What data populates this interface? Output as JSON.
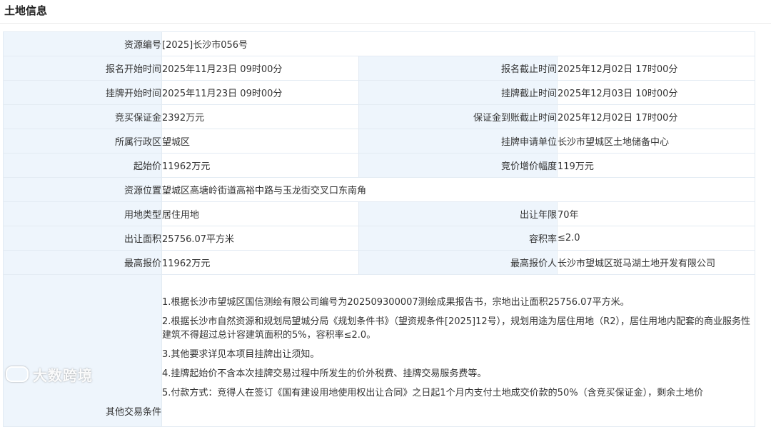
{
  "section_title": "土地信息",
  "rows": [
    {
      "label": "资源编号",
      "value": "[2025]长沙市056号"
    },
    {
      "label": "报名开始时间",
      "value": "2025年11月23日 09时00分",
      "label2": "报名截止时间",
      "value2": "2025年12月02日 17时00分"
    },
    {
      "label": "挂牌开始时间",
      "value": "2025年11月23日 09时00分",
      "label2": "挂牌截止时间",
      "value2": "2025年12月03日 10时00分"
    },
    {
      "label": "竞买保证金",
      "value": "2392万元",
      "label2": "保证金到账截止时间",
      "value2": "2025年12月02日 17时00分"
    },
    {
      "label": "所属行政区",
      "value": "望城区",
      "label2": "挂牌申请单位",
      "value2": "长沙市望城区土地储备中心"
    },
    {
      "label": "起始价",
      "value": "11962万元",
      "label2": "竞价增价幅度",
      "value2": "119万元"
    },
    {
      "label": "资源位置",
      "value": "望城区高塘岭街道高裕中路与玉龙街交叉口东南角"
    },
    {
      "label": "用地类型",
      "value": "居住用地",
      "label2": "出让年限",
      "value2": "70年"
    },
    {
      "label": "出让面积",
      "value": "25756.07平方米",
      "label2": "容积率",
      "value2": "≤2.0"
    },
    {
      "label": "最高报价",
      "value": "11962万元",
      "label2": "最高报价人",
      "value2": "长沙市望城区斑马湖土地开发有限公司"
    }
  ],
  "notes": {
    "label": "其他交易条件",
    "items": [
      "1.根据长沙市望城区国信测绘有限公司编号为202509300007测绘成果报告书，宗地出让面积25756.07平方米。",
      "2.根据长沙市自然资源和规划局望城分局《规划条件书》（望资规条件[2025]12号），规划用途为居住用地（R2），居住用地内配套的商业服务性建筑不得超过总计容建筑面积的5%，容积率≤2.0。",
      "3.其他要求详见本项目挂牌出让须知。",
      "4.挂牌起始价不含本次挂牌交易过程中所发生的价外税费、挂牌交易服务费等。",
      "5.付款方式：竞得人在签订《国有建设用地使用权出让合同》之日起1个月内支付土地成交价款的50%（含竞买保证金），剩余土地价"
    ]
  },
  "watermark": "大数跨境"
}
